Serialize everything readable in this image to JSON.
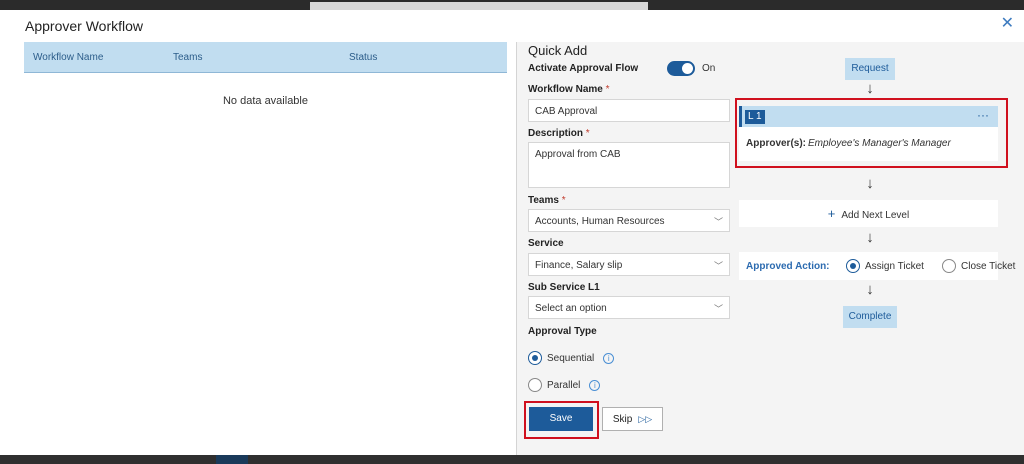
{
  "modal": {
    "title": "Approver Workflow",
    "close_icon": "close-icon"
  },
  "table": {
    "columns": [
      "Workflow Name",
      "Teams",
      "Status"
    ],
    "empty_text": "No data available"
  },
  "quick_add": {
    "title": "Quick Add",
    "activate_label": "Activate Approval Flow",
    "activate_state": "On",
    "workflow_name_label": "Workflow Name",
    "workflow_name_value": "CAB Approval",
    "description_label": "Description",
    "description_value": "Approval from CAB",
    "teams_label": "Teams",
    "teams_value": "Accounts, Human Resources",
    "service_label": "Service",
    "service_value": "Finance, Salary slip",
    "sub_service_label": "Sub Service L1",
    "sub_service_value": "Select an option",
    "approval_type_label": "Approval Type",
    "approval_types": [
      "Sequential",
      "Parallel"
    ],
    "approval_type_selected": "Sequential",
    "required_mark": "*",
    "save_label": "Save",
    "skip_label": "Skip"
  },
  "flow": {
    "request_label": "Request",
    "level_tag": "L 1",
    "level_menu": "···",
    "approver_label": "Approver(s):",
    "approver_value": "Employee's Manager's Manager",
    "add_level_label": "Add Next Level",
    "approved_action_label": "Approved Action:",
    "approved_actions": [
      "Assign Ticket",
      "Close Ticket"
    ],
    "approved_action_selected": "Assign Ticket",
    "complete_label": "Complete"
  },
  "colors": {
    "accent": "#1d5b9a",
    "header_bg": "#c1ddf0",
    "highlight": "#d0101e"
  }
}
